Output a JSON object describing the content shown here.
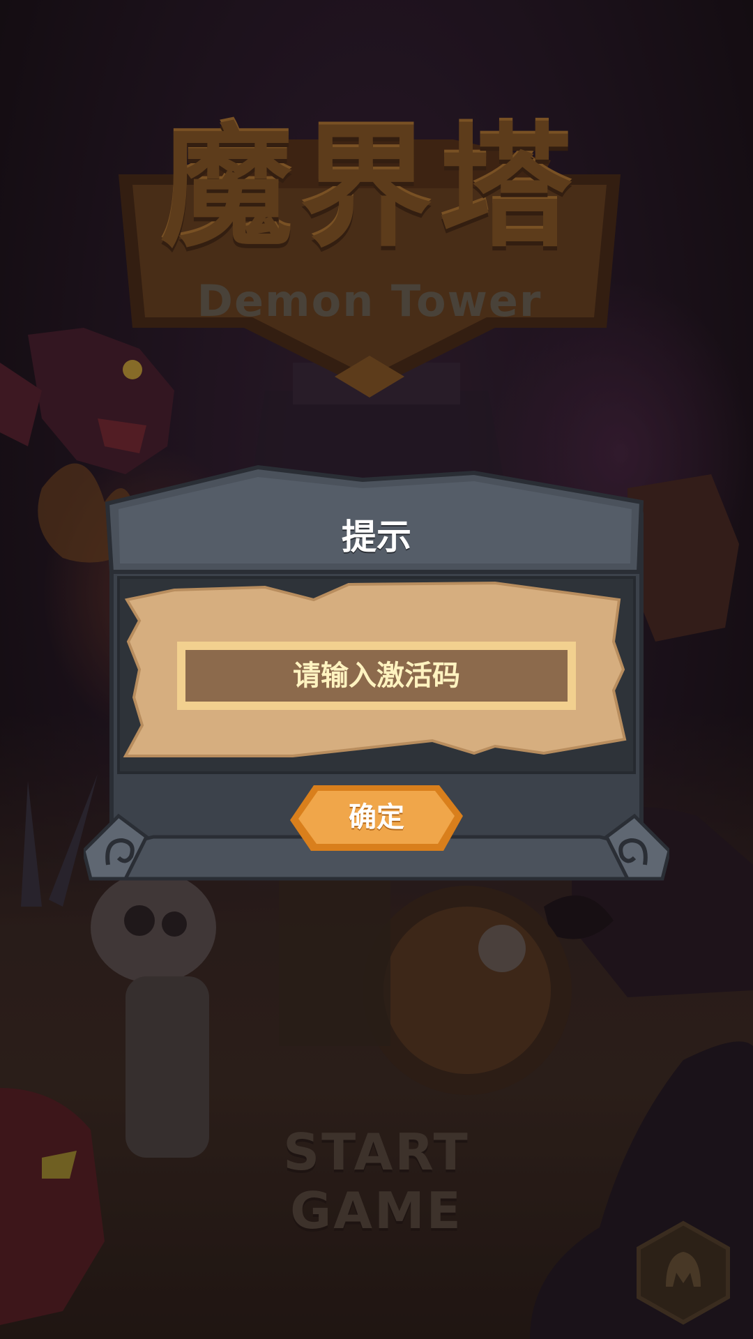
{
  "logo": {
    "title": "魔界塔",
    "subtitle": "Demon Tower"
  },
  "start_game": {
    "label": "START GAME"
  },
  "dialog": {
    "title": "提示",
    "input": {
      "placeholder": "请输入激活码",
      "value": ""
    },
    "confirm_label": "确定"
  },
  "colors": {
    "dialog_frame": "#4b525c",
    "parchment": "#d6ae7f",
    "input_bg": "#8c6a4c",
    "input_border": "#f2d08f",
    "button_fill": "#f0a64a",
    "button_border": "#d97f1c",
    "logo_gold": "#8a5a26"
  },
  "icons": {
    "corner_badge": "monster-emblem-icon",
    "dialog_ornament": "spiral-ornament-icon"
  }
}
